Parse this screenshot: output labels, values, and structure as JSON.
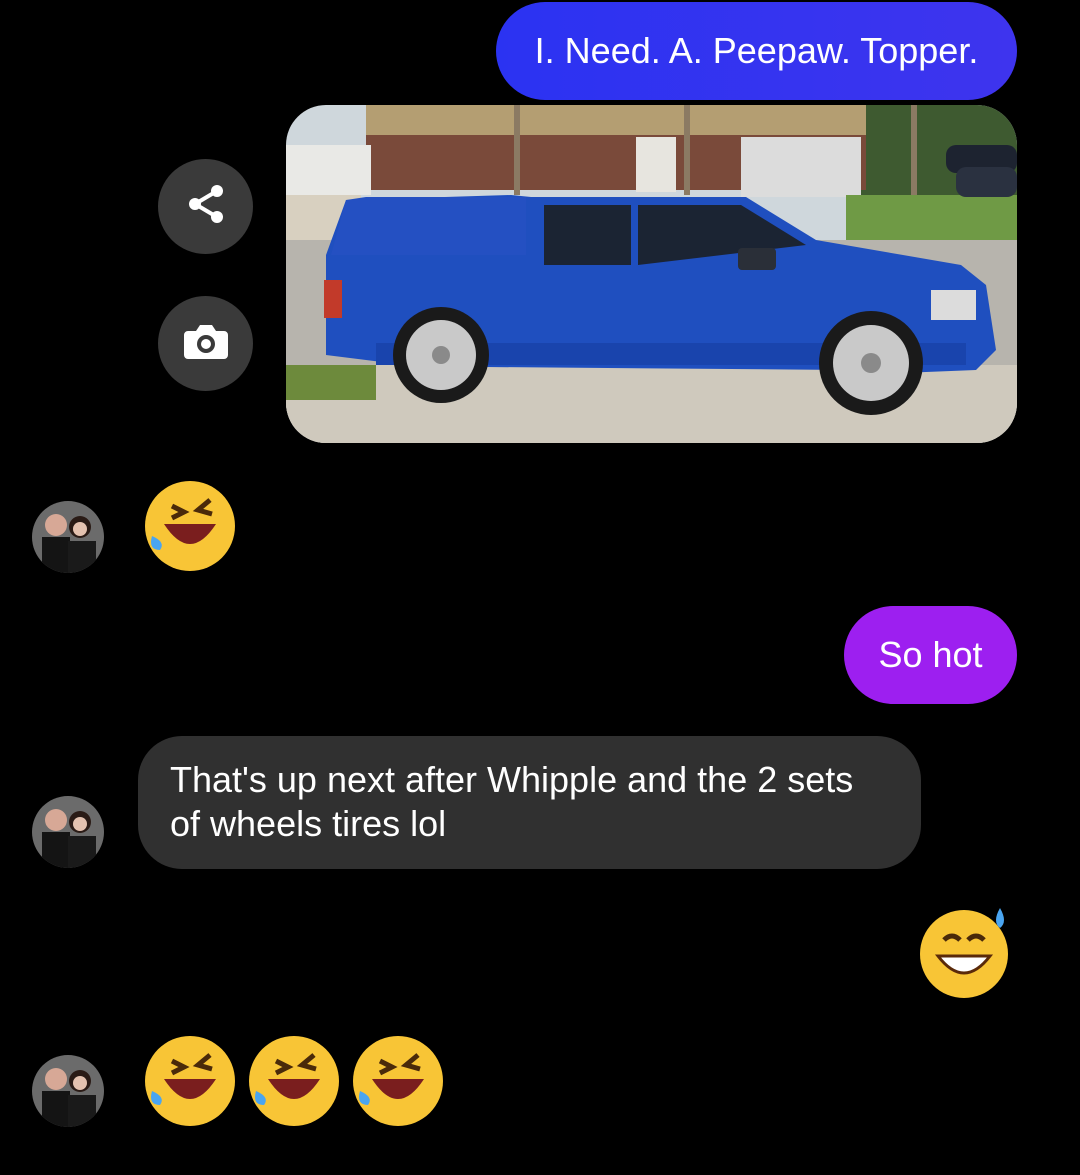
{
  "conversation": {
    "messages": [
      {
        "side": "sent",
        "type": "text",
        "text": "I. Need. A. Peepaw. Topper."
      },
      {
        "side": "sent",
        "type": "photo",
        "alt": ""
      },
      {
        "side": "received",
        "type": "emoji",
        "emoji": [
          "rolling-on-floor-laughing"
        ]
      },
      {
        "side": "sent",
        "type": "text",
        "text": "So hot"
      },
      {
        "side": "received",
        "type": "text",
        "text": "That's up next after Whipple and the 2 sets of wheels tires lol"
      },
      {
        "side": "sent",
        "type": "emoji",
        "emoji": [
          "grinning-face-with-sweat"
        ]
      },
      {
        "side": "received",
        "type": "emoji",
        "emoji": [
          "rolling-on-floor-laughing",
          "rolling-on-floor-laughing",
          "rolling-on-floor-laughing"
        ]
      }
    ]
  },
  "photo_actions": {
    "share_icon": "share-icon",
    "camera_icon": "camera-icon"
  },
  "colors": {
    "background": "#000000",
    "sent_bubble_blue": "#2b33f2",
    "sent_bubble_purple": "#9d1ff0",
    "received_bubble": "#303030"
  }
}
